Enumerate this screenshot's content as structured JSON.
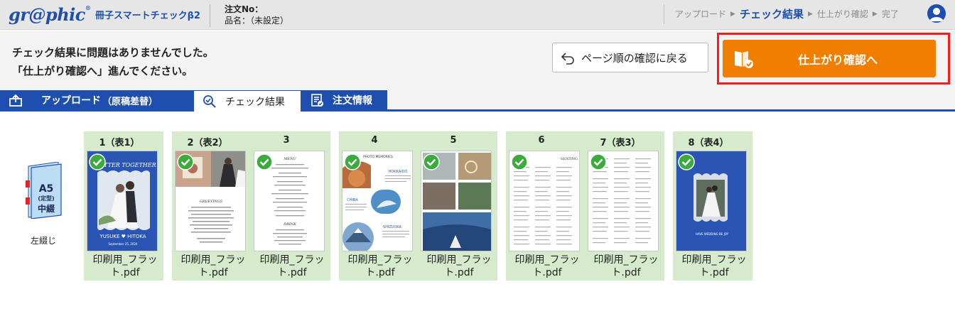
{
  "header": {
    "logo": "gr@phic",
    "logo_mark": "®",
    "app_name": "冊子スマートチェックβ2",
    "order_no_label": "注文No：",
    "product_label": "品名：（未設定）",
    "steps": [
      {
        "label": "アップロード",
        "active": false
      },
      {
        "label": "チェック結果",
        "active": true
      },
      {
        "label": "仕上がり確認",
        "active": false
      },
      {
        "label": "完了",
        "active": false
      }
    ],
    "step_arrow": "▶"
  },
  "message": {
    "line1": "チェック結果に問題はありませんでした。",
    "line2": "「仕上がり確認へ」進んでください。"
  },
  "buttons": {
    "back_label": "ページ順の確認に戻る",
    "finish_label": "仕上がり確認へ",
    "accent_color": "#f07f00",
    "highlight_color": "#ff1a1a"
  },
  "tabs": {
    "upload_label": "アップロード",
    "upload_sub": "（原稿差替）",
    "check_label": "チェック結果",
    "order_label": "注文情報"
  },
  "book": {
    "size": "A5",
    "type": "(定型)",
    "binding": "中綴",
    "binding_side": "左綴じ"
  },
  "pages": [
    {
      "num": "1（表1）",
      "file": "印刷用_フラット.pdf",
      "status": "ok"
    },
    {
      "num": "2（表2）",
      "file": "印刷用_フラット.pdf",
      "status": "ok"
    },
    {
      "num": "3",
      "file": "印刷用_フラット.pdf",
      "status": "ok"
    },
    {
      "num": "4",
      "file": "印刷用_フラット.pdf",
      "status": "ok"
    },
    {
      "num": "5",
      "file": "印刷用_フラット.pdf",
      "status": "ok"
    },
    {
      "num": "6",
      "file": "印刷用_フラット.pdf",
      "status": "ok"
    },
    {
      "num": "7（表3）",
      "file": "印刷用_フラット.pdf",
      "status": "ok"
    },
    {
      "num": "8（表4）",
      "file": "印刷用_フラット.pdf",
      "status": "ok"
    }
  ],
  "thumb_text": {
    "p1_title": "BETTER TOGETHER",
    "p1_names": "YUSUKE ♥ HITOKA",
    "p1_date": "September 25, 2024",
    "p2_heading": "GREETINGS",
    "p3_heading": "MENU",
    "p3_heading2": "DRINK",
    "p4_title": "PHOTO MEMORIES",
    "p4_place1": "HOKKAIDO",
    "p4_place2": "CHIBA",
    "p4_place3": "SHIZUOKA",
    "p6_title": "SEATING",
    "p8_text": "HAVE WEDDING BE JOY"
  },
  "colors": {
    "brand_blue": "#1e4fae",
    "spread_green": "#d5ebcc",
    "check_green": "#3caa3c"
  }
}
